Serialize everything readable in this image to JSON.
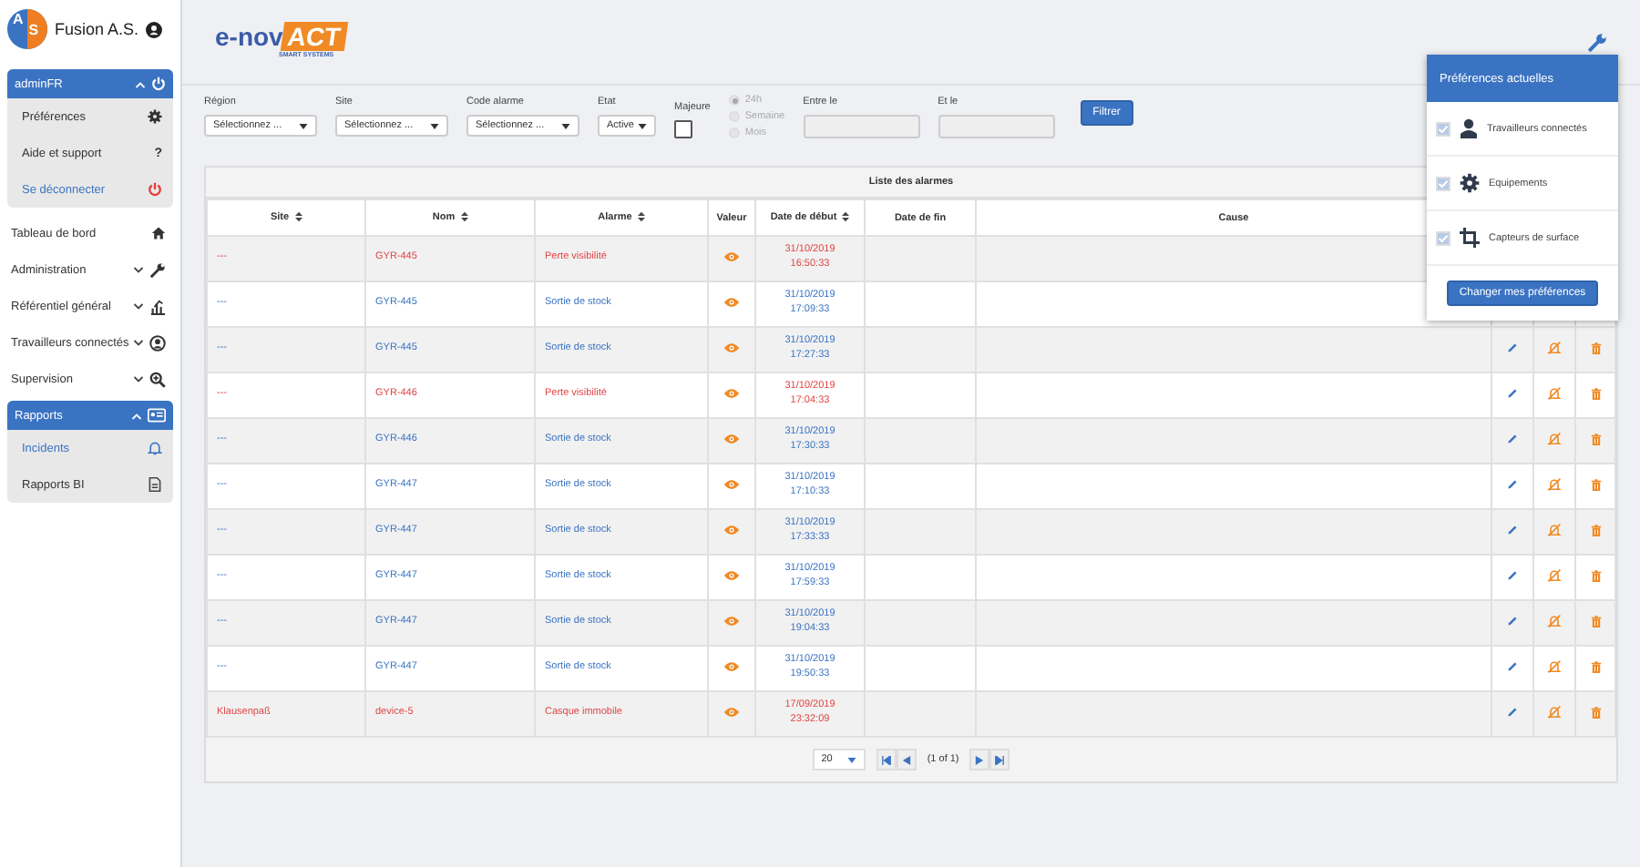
{
  "sidebar": {
    "brand": "Fusion A.S.",
    "logo_letters": [
      "A",
      "S"
    ],
    "user": {
      "name": "adminFR",
      "expanded": true,
      "items": [
        {
          "label": "Préférences",
          "kind": "gear"
        },
        {
          "label": "Aide et support",
          "kind": "help",
          "glyph": "?"
        },
        {
          "label": "Se déconnecter",
          "kind": "logout"
        }
      ]
    },
    "nav": [
      {
        "label": "Tableau de bord",
        "kind": "home",
        "expandable": false,
        "expanded": false
      },
      {
        "label": "Administration",
        "kind": "wrench",
        "expandable": true,
        "expanded": false
      },
      {
        "label": "Référentiel général",
        "kind": "chart",
        "expandable": true,
        "expanded": false
      },
      {
        "label": "Travailleurs connectés",
        "kind": "user",
        "expandable": true,
        "expanded": false
      },
      {
        "label": "Supervision",
        "kind": "zoom",
        "expandable": true,
        "expanded": false
      },
      {
        "label": "Rapports",
        "kind": "card",
        "expandable": true,
        "expanded": true,
        "children": [
          {
            "label": "Incidents",
            "kind": "bell",
            "selected": true
          },
          {
            "label": "Rapports BI",
            "kind": "doc",
            "selected": false
          }
        ]
      }
    ]
  },
  "header": {
    "logo": {
      "part1": "e-nov",
      "part2": "ACT",
      "tagline": "SMART SYSTEMS"
    }
  },
  "filters": {
    "selects": [
      {
        "label": "Région",
        "value": "Sélectionnez ..."
      },
      {
        "label": "Site",
        "value": "Sélectionnez ..."
      },
      {
        "label": "Code alarme",
        "value": "Sélectionnez ..."
      },
      {
        "label": "Etat",
        "value": "Active"
      }
    ],
    "majeure": {
      "label": "Majeure",
      "checked": false
    },
    "period": [
      {
        "label": "24h",
        "selected": true
      },
      {
        "label": "Semaine",
        "selected": false
      },
      {
        "label": "Mois",
        "selected": false
      }
    ],
    "dates": [
      {
        "label": "Entre le"
      },
      {
        "label": "Et le"
      }
    ],
    "button": "Filtrer"
  },
  "table": {
    "title": "Liste des alarmes",
    "columns": [
      {
        "label": "Site",
        "sortable": true
      },
      {
        "label": "Nom",
        "sortable": true
      },
      {
        "label": "Alarme",
        "sortable": true
      },
      {
        "label": "Valeur",
        "sortable": false
      },
      {
        "label": "Date de début",
        "sortable": true
      },
      {
        "label": "Date de fin",
        "sortable": false
      },
      {
        "label": "Cause",
        "sortable": false
      }
    ],
    "rows": [
      {
        "site": "---",
        "nom": "GYR-445",
        "alarme": "Perte visibilité",
        "date": "31/10/2019",
        "time": "16:50:33",
        "critical": true,
        "actions": false
      },
      {
        "site": "---",
        "nom": "GYR-445",
        "alarme": "Sortie de stock",
        "date": "31/10/2019",
        "time": "17:09:33",
        "critical": false,
        "actions": false
      },
      {
        "site": "---",
        "nom": "GYR-445",
        "alarme": "Sortie de stock",
        "date": "31/10/2019",
        "time": "17:27:33",
        "critical": false,
        "actions": true
      },
      {
        "site": "---",
        "nom": "GYR-446",
        "alarme": "Perte visibilité",
        "date": "31/10/2019",
        "time": "17:04:33",
        "critical": true,
        "actions": true
      },
      {
        "site": "---",
        "nom": "GYR-446",
        "alarme": "Sortie de stock",
        "date": "31/10/2019",
        "time": "17:30:33",
        "critical": false,
        "actions": true
      },
      {
        "site": "---",
        "nom": "GYR-447",
        "alarme": "Sortie de stock",
        "date": "31/10/2019",
        "time": "17:10:33",
        "critical": false,
        "actions": true
      },
      {
        "site": "---",
        "nom": "GYR-447",
        "alarme": "Sortie de stock",
        "date": "31/10/2019",
        "time": "17:33:33",
        "critical": false,
        "actions": true
      },
      {
        "site": "---",
        "nom": "GYR-447",
        "alarme": "Sortie de stock",
        "date": "31/10/2019",
        "time": "17:59:33",
        "critical": false,
        "actions": true
      },
      {
        "site": "---",
        "nom": "GYR-447",
        "alarme": "Sortie de stock",
        "date": "31/10/2019",
        "time": "19:04:33",
        "critical": false,
        "actions": true
      },
      {
        "site": "---",
        "nom": "GYR-447",
        "alarme": "Sortie de stock",
        "date": "31/10/2019",
        "time": "19:50:33",
        "critical": false,
        "actions": true
      },
      {
        "site": "Klausenpaß",
        "nom": "device-5",
        "alarme": "Casque immobile",
        "date": "17/09/2019",
        "time": "23:32:09",
        "critical": true,
        "actions": true
      }
    ],
    "pagination": {
      "page_size": "20",
      "page_info": "(1 of 1)"
    }
  },
  "preferences_popup": {
    "title": "Préférences actuelles",
    "items": [
      {
        "label": "Travailleurs connectés",
        "kind": "user",
        "checked": true
      },
      {
        "label": "Equipements",
        "kind": "gear",
        "checked": true
      },
      {
        "label": "Capteurs de surface",
        "kind": "crop",
        "checked": true
      }
    ],
    "button": "Changer mes préférences"
  }
}
